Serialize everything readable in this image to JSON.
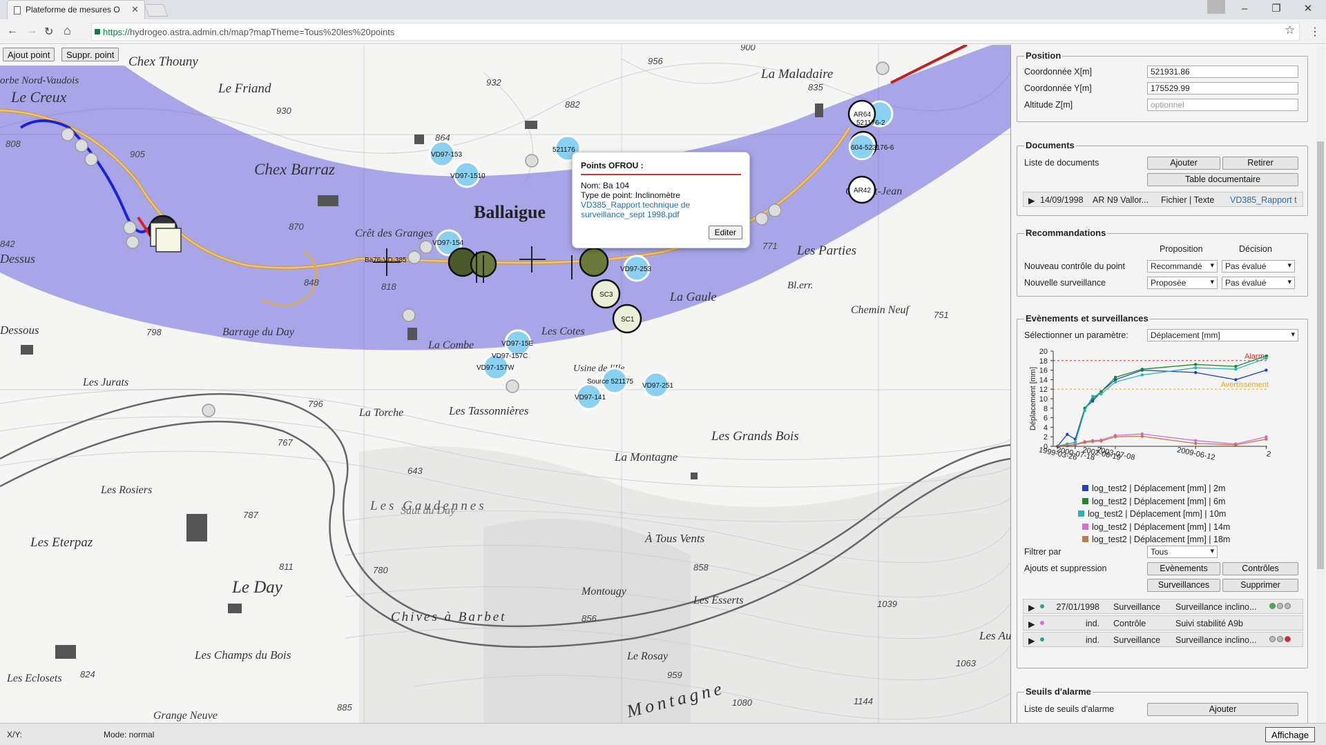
{
  "browser": {
    "tab_title": "Plateforme de mesures O",
    "url_scheme": "https://",
    "url_rest": "hydrogeo.astra.admin.ch/map?mapTheme=Tous%20les%20points"
  },
  "map": {
    "buttons": {
      "add_point": "Ajout point",
      "remove_point": "Suppr. point"
    },
    "place_names": [
      "Chex Thouny",
      "Le Friand",
      "Le Creux",
      "orbe Nord-Vaudois",
      "Chex Barraz",
      "Ballaigue",
      "La Maladaire",
      "Côte St-Jean",
      "Crêt des Granges",
      "Les Parties",
      "La Gaule",
      "Bl.err.",
      "Les Cotes",
      "Chemin Neuf",
      "Dessus",
      "Barrage du Day",
      "Les Jurats",
      "La Torche",
      "Les Tassonnières",
      "Les Grands Bois",
      "La Montagne",
      "Saut du Day",
      "Les Gaudennes",
      "Les Rosiers",
      "Les Eterpaz",
      "À Tous Vents",
      "Le Day",
      "Montougy",
      "Les Esserts",
      "Chives à Barbet",
      "Le Rosay",
      "Les Champs du Bois",
      "Les Eclosets",
      "Grange Neuve",
      "Montagne",
      "La Combe",
      "Usine de l'Ile",
      "Dessous",
      "Les Au"
    ],
    "point_labels": [
      "VD97-153",
      "VD97-1510",
      "VD97-154",
      "VD97-253",
      "VD97-15E",
      "VD97-157C",
      "VD97-157W",
      "VD97-141",
      "Source 521175",
      "VD97-251",
      "SC3",
      "SC1",
      "AR64",
      "AR42",
      "521176-2",
      "604-523176-6",
      "Ba76-VD-385",
      "521176"
    ]
  },
  "popup": {
    "title": "Points OFROU :",
    "name": "Nom: Ba 104",
    "type": "Type de point: Inclinomètre",
    "link_line1": "VD385_Rapport technique de",
    "link_line2": "surveillance_sept 1998.pdf",
    "edit_label": "Editer"
  },
  "status": {
    "xy": "X/Y:",
    "mode": "Mode: normal",
    "display_button": "Affichage"
  },
  "panel": {
    "position": {
      "legend": "Position",
      "x_label": "Coordonnée X[m]",
      "x_value": "521931.86",
      "y_label": "Coordonnée Y[m]",
      "y_value": "175529.99",
      "z_label": "Altitude Z[m]",
      "z_placeholder": "optionnel"
    },
    "documents": {
      "legend": "Documents",
      "list_label": "Liste de documents",
      "add": "Ajouter",
      "remove": "Retirer",
      "table": "Table documentaire",
      "row": {
        "date": "14/09/1998",
        "title": "AR N9 Vallor...",
        "type": "Fichier | Texte",
        "link": "VD385_Rapport t"
      }
    },
    "recommandations": {
      "legend": "Recommandations",
      "col_proposition": "Proposition",
      "col_decision": "Décision",
      "rows": [
        {
          "label": "Nouveau contrôle du point",
          "proposition": "Recommandé",
          "decision": "Pas évalué"
        },
        {
          "label": "Nouvelle surveillance",
          "proposition": "Proposée",
          "decision": "Pas évalué"
        }
      ]
    },
    "events": {
      "legend": "Evènements et surveillances",
      "param_label": "Sélectionner un paramètre:",
      "param_value": "Déplacement [mm]",
      "filter_label": "Filtrer par",
      "filter_value": "Tous",
      "add_remove_label": "Ajouts et suppression",
      "btn_events": "Evènements",
      "btn_controls": "Contrôles",
      "btn_surveillances": "Surveillances",
      "btn_delete": "Supprimer",
      "rows": [
        {
          "dot_color": "#2aa198",
          "date": "27/01/1998",
          "kind": "Surveillance",
          "desc": "Surveillance inclino...",
          "lights": [
            "#3cb44b",
            "#bbbbbb",
            "#bbbbbb"
          ]
        },
        {
          "dot_color": "#d66bd6",
          "date": "ind.",
          "kind": "Contrôle",
          "desc": "Suivi stabilité A9b",
          "lights": []
        },
        {
          "dot_color": "#2aa198",
          "date": "ind.",
          "kind": "Surveillance",
          "desc": "Surveillance inclino...",
          "lights": [
            "#bbbbbb",
            "#bbbbbb",
            "#e62020"
          ]
        }
      ]
    },
    "thresholds": {
      "legend": "Seuils d'alarme",
      "list_label": "Liste de seuils d'alarme",
      "add": "Ajouter"
    }
  },
  "chart_data": {
    "type": "line",
    "ylabel": "Déplacement [mm]",
    "ylim": [
      0,
      20
    ],
    "yticks": [
      0,
      2,
      4,
      6,
      8,
      10,
      12,
      14,
      16,
      18,
      20
    ],
    "x_tick_labels": [
      "1999-03-26",
      "2000-07-18",
      "2002-06-19",
      "2003-07-08",
      "2009-06-12",
      "2"
    ],
    "x_tick_dates": [
      "1999-03-26",
      "2000-07-18",
      "2002-06-19",
      "2003-07-08",
      "2009-06-12",
      "2014-09-01"
    ],
    "xlim_dates": [
      "1998-12-01",
      "2014-10-01"
    ],
    "thresholds": [
      {
        "label": "Alarme",
        "value": 18,
        "color": "#d62728"
      },
      {
        "label": "Avertissement",
        "value": 12,
        "color": "#e6a817"
      }
    ],
    "series": [
      {
        "name": "log_test2 | Déplacement [mm] | 2m",
        "color": "#1f3fd1",
        "points": [
          [
            "1999-03-26",
            0
          ],
          [
            "1999-12-15",
            2.5
          ],
          [
            "2000-07-18",
            1.5
          ],
          [
            "2001-04-01",
            8
          ],
          [
            "2001-11-01",
            9.5
          ],
          [
            "2002-06-19",
            11.5
          ],
          [
            "2003-07-08",
            14
          ],
          [
            "2005-07-01",
            16
          ],
          [
            "2009-06-12",
            15.5
          ],
          [
            "2012-06-01",
            14
          ],
          [
            "2014-09-01",
            16
          ]
        ]
      },
      {
        "name": "log_test2 | Déplacement [mm] | 6m",
        "color": "#1e8a2e",
        "points": [
          [
            "1999-03-26",
            0
          ],
          [
            "1999-12-15",
            0.5
          ],
          [
            "2000-07-18",
            0.8
          ],
          [
            "2001-04-01",
            8
          ],
          [
            "2001-11-01",
            10
          ],
          [
            "2002-06-19",
            11.5
          ],
          [
            "2003-07-08",
            14.5
          ],
          [
            "2005-07-01",
            16.2
          ],
          [
            "2009-06-12",
            17.2
          ],
          [
            "2012-06-01",
            16.8
          ],
          [
            "2014-09-01",
            19
          ]
        ]
      },
      {
        "name": "log_test2 | Déplacement [mm] | 10m",
        "color": "#2ab3b0",
        "points": [
          [
            "1999-03-26",
            0
          ],
          [
            "1999-12-15",
            0.5
          ],
          [
            "2000-07-18",
            0.8
          ],
          [
            "2001-04-01",
            7.5
          ],
          [
            "2001-11-01",
            10.5
          ],
          [
            "2002-06-19",
            11
          ],
          [
            "2003-07-08",
            13.5
          ],
          [
            "2005-07-01",
            15
          ],
          [
            "2009-06-12",
            16.5
          ],
          [
            "2012-06-01",
            16.2
          ],
          [
            "2014-09-01",
            18.5
          ]
        ]
      },
      {
        "name": "log_test2 | Déplacement [mm] | 14m",
        "color": "#d66bd6",
        "points": [
          [
            "1999-03-26",
            0
          ],
          [
            "1999-12-15",
            0.2
          ],
          [
            "2000-07-18",
            0.4
          ],
          [
            "2001-04-01",
            1
          ],
          [
            "2001-11-01",
            1.2
          ],
          [
            "2002-06-19",
            1.3
          ],
          [
            "2003-07-08",
            2.3
          ],
          [
            "2005-07-01",
            2.6
          ],
          [
            "2009-06-12",
            1.2
          ],
          [
            "2012-06-01",
            0.5
          ],
          [
            "2014-09-01",
            2
          ]
        ]
      },
      {
        "name": "log_test2 | Déplacement [mm] | 18m",
        "color": "#c47a3a",
        "points": [
          [
            "1999-03-26",
            0
          ],
          [
            "1999-12-15",
            0.1
          ],
          [
            "2000-07-18",
            0.3
          ],
          [
            "2001-04-01",
            0.8
          ],
          [
            "2001-11-01",
            1
          ],
          [
            "2002-06-19",
            1.1
          ],
          [
            "2003-07-08",
            2
          ],
          [
            "2005-07-01",
            2.1
          ],
          [
            "2009-06-12",
            0.6
          ],
          [
            "2012-06-01",
            0.3
          ],
          [
            "2014-09-01",
            1.5
          ]
        ]
      }
    ]
  },
  "icons": {
    "back": "←",
    "forward": "→",
    "reload": "↻",
    "home": "⌂",
    "star": "☆",
    "menu": "⋮",
    "minimize": "–",
    "maximize": "❐",
    "close": "✕",
    "expand": "▶"
  }
}
